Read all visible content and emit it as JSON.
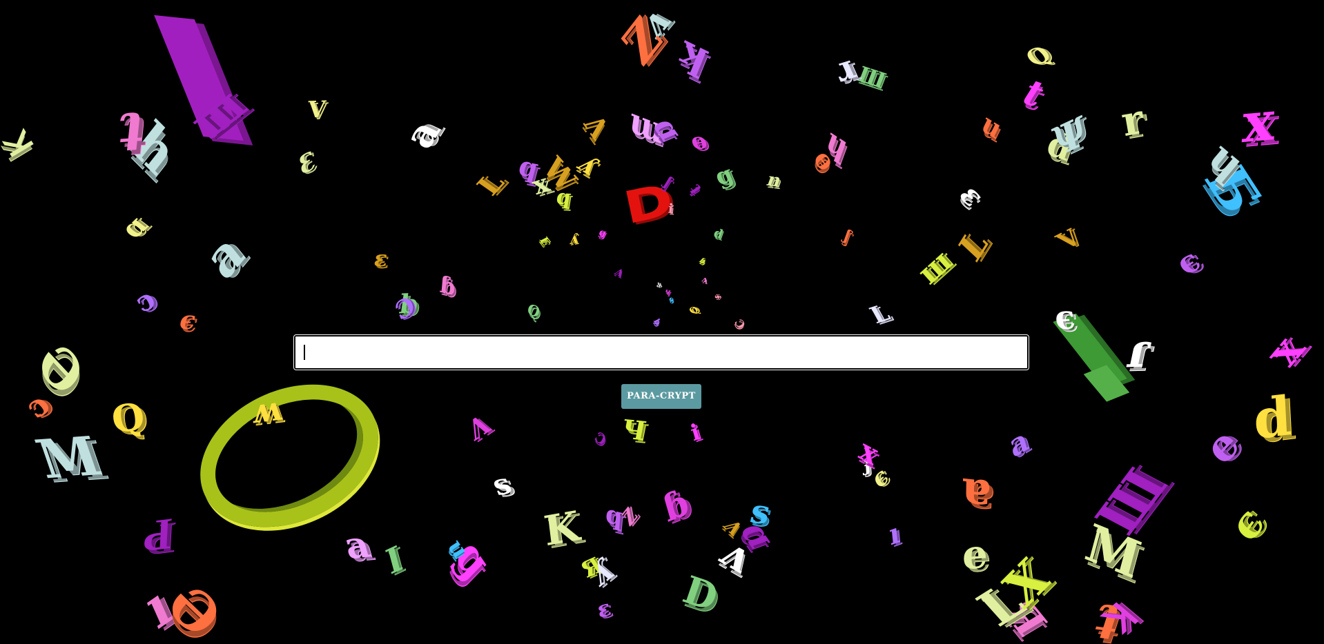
{
  "page": {
    "background": "#000000"
  },
  "search": {
    "value": "",
    "placeholder": ""
  },
  "action": {
    "label": "PARA-CRYPT",
    "color": "#5b9aa0"
  },
  "backdrop": {
    "description_icon": "floating-3d-letters",
    "featured_letter": "D",
    "featured_color": "#e4120f",
    "ring_color": "#a8c21a",
    "glyphs": [
      "X",
      "Q",
      "Б",
      "M",
      "ш",
      "a",
      "ʎ",
      "d",
      "Λ",
      "b",
      "q",
      "ɐ",
      "K",
      "D",
      "ε",
      "є",
      "o",
      "t",
      "i",
      "q",
      "ɟ",
      "ʞ",
      "Я",
      "W",
      "x",
      "ı",
      "n",
      "H",
      "Ч",
      "V",
      "Ʞ",
      "ɔ",
      "ʃ",
      "ɥ",
      "e",
      "s",
      "g",
      "u",
      "ʌ",
      "Ԁ",
      "ɯ",
      "L",
      "Ɔ",
      "K",
      "x",
      "h",
      "ɑ",
      "L",
      "Ψ",
      "Ԑ",
      "ʇ",
      "E",
      "ʍ",
      "ɾ",
      "I",
      "Z",
      "ɹ",
      "ↄ",
      "Ə",
      "ɓ",
      "r",
      "Ш",
      "ɵ"
    ]
  }
}
